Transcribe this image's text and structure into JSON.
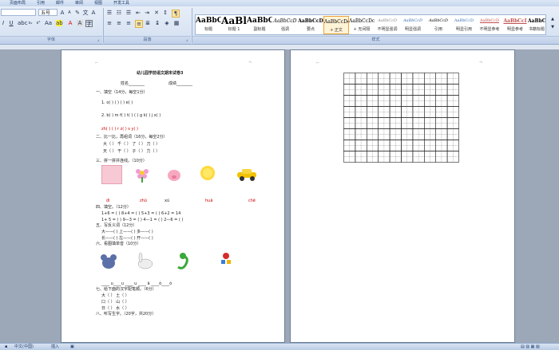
{
  "menu": [
    "页面布局",
    "引用",
    "邮件",
    "审阅",
    "视图",
    "开发工具"
  ],
  "ribbon": {
    "font_size": "五号",
    "group_labels": {
      "font": "字体",
      "paragraph": "段落",
      "styles": "样式"
    },
    "styles": [
      {
        "preview": "AaBbC",
        "name": "标题"
      },
      {
        "preview": "AaBl",
        "name": "标题 1"
      },
      {
        "preview": "AaBbC",
        "name": "副标题"
      },
      {
        "preview": "AaBbCcD",
        "name": "强调"
      },
      {
        "preview": "AaBbCcD",
        "name": "要点"
      },
      {
        "preview": "AaBbCcDc",
        "name": "+ 正文"
      },
      {
        "preview": "AaBbCcDc",
        "name": "+ 无间隔"
      },
      {
        "preview": "AaBbCcD",
        "name": "不明显强调"
      },
      {
        "preview": "AaBbCcD",
        "name": "明显强调"
      },
      {
        "preview": "AaBbCcD",
        "name": "引用"
      },
      {
        "preview": "AaBbCcD",
        "name": "明显引用"
      },
      {
        "preview": "AaBbCcD",
        "name": "不明显参考"
      },
      {
        "preview": "AaBbCcI",
        "name": "明显参考"
      },
      {
        "preview": "AaBbCcI",
        "name": "书籍标题"
      }
    ]
  },
  "document": {
    "title": "幼儿园学前语文期末试卷3",
    "name_label": "姓名________",
    "score_label": "成绩________",
    "sections": {
      "s1": "一、填空（14分，每空1分）",
      "s1_rows": [
        "1. o(    ) (    ) (    ) e(    )",
        "2. b(    ) m  f(    ) t(    ) (    ) g  k(    ) j  x(    )",
        "zh(    ) (    ) r  z(    ) s  y(    )"
      ],
      "s2": "二、比一比，再组词（16分，每空2分）",
      "s2_rows": [
        "大（    ）  千（    ）  了（    ）  刀（    ）",
        "天（    ）  干（    ）  子（    ）  力（    ）"
      ],
      "s3": "三、拼一拼并连线。（10分）",
      "s3_words": [
        "dì",
        "zhū",
        "xú",
        "huā",
        "chē"
      ],
      "s4": "四、填空。（12分）",
      "s4_rows": [
        "1+6 = (    )   8+4 = (    )   5+3 = (    )   6+2 = 14",
        "1+ 5 = (    )   9—3 = (    )   4—1 = (    )   2—6 = (    )"
      ],
      "s5": "五、写反义词（12分）",
      "s5_rows": [
        "大——(    )     上——(    )     多——(    )",
        "长——(    )     左——(    )     开——(    )"
      ],
      "s6": "六、看图填单音（10分）",
      "s6_blanks": "____ u____u   ____ u   ____ ä   ____ò____ó",
      "s7": "七、给下面的汉字配笔顺。（6分）",
      "s7_rows": [
        "大（      ）   土（    ）",
        "口（      ）   山（    ）",
        "日（      ）   水（    ）"
      ],
      "s8": "八、听写生字。（20字，共20分）"
    }
  },
  "status": {
    "language": "中文(中国)",
    "mode": "插入"
  }
}
